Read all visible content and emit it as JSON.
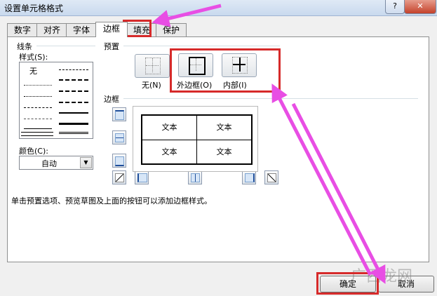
{
  "window": {
    "title": "设置单元格格式",
    "help": "?",
    "close": "✕"
  },
  "tabs": [
    "数字",
    "对齐",
    "字体",
    "边框",
    "填充",
    "保护"
  ],
  "active_tab": "边框",
  "line": {
    "group_label": "线条",
    "style_label": "样式(S):",
    "none_label": "无",
    "color_label": "颜色(C):",
    "color_value": "自动"
  },
  "presets": {
    "group_label": "预置",
    "none": "无(N)",
    "outline": "外边框(O)",
    "inside": "内部(I)"
  },
  "border": {
    "group_label": "边框",
    "cells": [
      "文本",
      "文本",
      "文本",
      "文本"
    ]
  },
  "hint": "单击预置选项、预览草图及上面的按钮可以添加边框样式。",
  "buttons": {
    "ok": "确定",
    "cancel": "取消"
  },
  "watermark": "广西龙网",
  "colors": {
    "highlight": "#d62a2a",
    "arrow": "#e84ee4"
  }
}
